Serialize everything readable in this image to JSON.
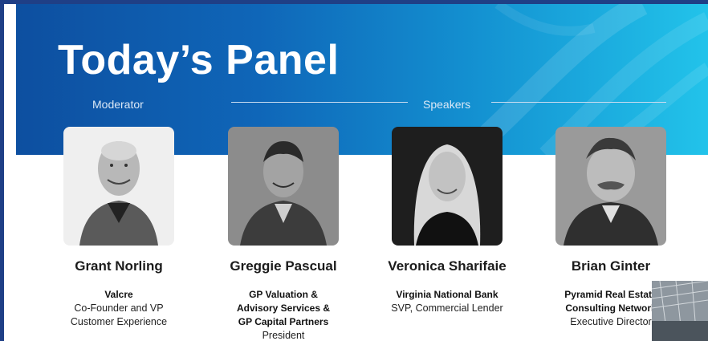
{
  "slide": {
    "title": "Today’s Panel",
    "moderator_label": "Moderator",
    "speakers_label": "Speakers"
  },
  "panelists": [
    {
      "name": "Grant Norling",
      "org": [
        "Valcre"
      ],
      "role": [
        "Co-Founder and VP",
        "Customer Experience"
      ],
      "org_bold": true
    },
    {
      "name": "Greggie Pascual",
      "org": [
        "GP Valuation &",
        "Advisory Services &",
        "GP Capital Partners"
      ],
      "role": [
        "President"
      ]
    },
    {
      "name": "Veronica Sharifaie",
      "org": [
        "Virginia National Bank"
      ],
      "role": [
        "SVP, Commercial Lender"
      ]
    },
    {
      "name": "Brian Ginter",
      "org": [
        "Pyramid Real Estate",
        "Consulting Network"
      ],
      "role": [
        "Executive Director"
      ]
    }
  ],
  "colors": {
    "banner_start": "#0d4fa0",
    "banner_end": "#22c3ea",
    "frame": "#1f3f86"
  }
}
